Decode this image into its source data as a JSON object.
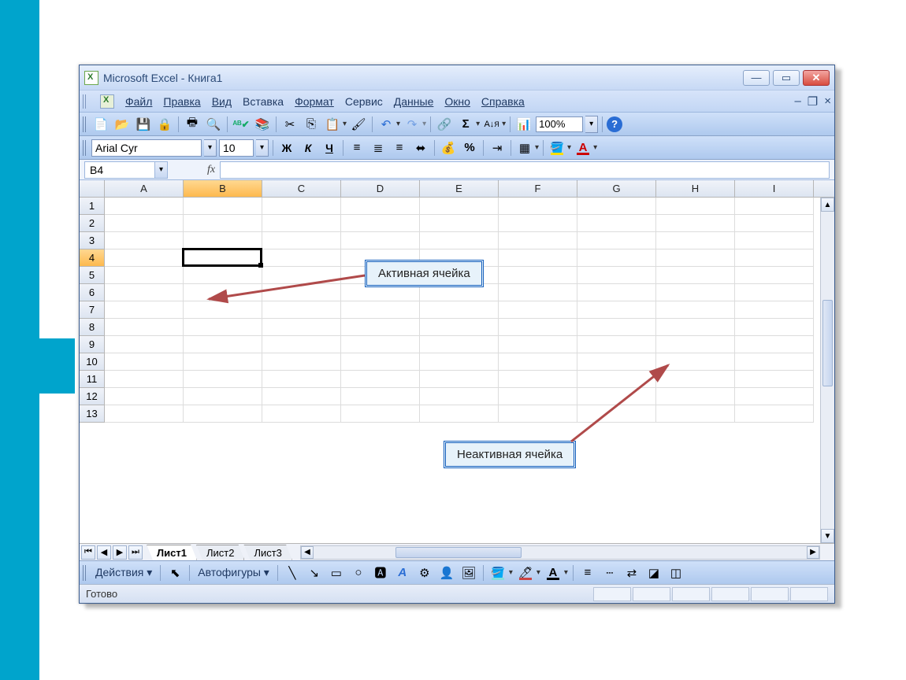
{
  "window": {
    "title": "Microsoft Excel - Книга1"
  },
  "menu": {
    "file": "Файл",
    "edit": "Правка",
    "view": "Вид",
    "insert": "Вставка",
    "format": "Формат",
    "service": "Сервис",
    "data": "Данные",
    "window_m": "Окно",
    "help": "Справка"
  },
  "toolbar": {
    "zoom": "100%"
  },
  "formatting": {
    "font": "Arial Cyr",
    "size": "10"
  },
  "namebox": {
    "ref": "B4"
  },
  "columns": [
    "A",
    "B",
    "C",
    "D",
    "E",
    "F",
    "G",
    "H",
    "I"
  ],
  "rows": [
    "1",
    "2",
    "3",
    "4",
    "5",
    "6",
    "7",
    "8",
    "9",
    "10",
    "11",
    "12",
    "13"
  ],
  "active": {
    "col_index": 1,
    "row_index": 3
  },
  "sheets": {
    "s1": "Лист1",
    "s2": "Лист2",
    "s3": "Лист3"
  },
  "drawing": {
    "actions": "Действия",
    "autoshapes": "Автофигуры"
  },
  "status": {
    "text": "Готово"
  },
  "callouts": {
    "active": "Активная ячейка",
    "inactive": "Неактивная ячейка"
  }
}
